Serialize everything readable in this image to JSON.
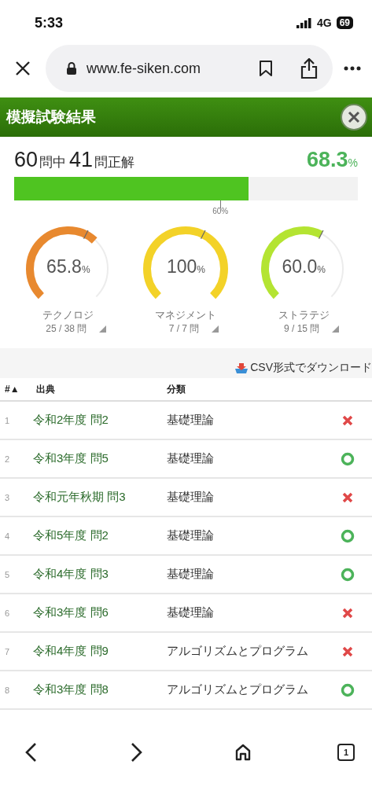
{
  "status_bar": {
    "time": "5:33",
    "network": "4G",
    "battery": "69"
  },
  "browser": {
    "url": "www.fe-siken.com"
  },
  "header": {
    "title": "模擬試験結果"
  },
  "score": {
    "total": "60",
    "total_unit": "問中",
    "correct": "41",
    "correct_unit": "問正解",
    "rate": "68.3",
    "rate_unit": "%",
    "level": 0.683,
    "pass_mark": "60%"
  },
  "gauges": [
    {
      "value": "65.8",
      "unit": "%",
      "color": "#e8892f",
      "label": "テクノロジ",
      "count": "25 / 38 問"
    },
    {
      "value": "100",
      "unit": "%",
      "color": "#f3d228",
      "label": "マネジメント",
      "count": "7 / 7 問"
    },
    {
      "value": "60.0",
      "unit": "%",
      "color": "#b4e432",
      "label": "ストラテジ",
      "count": "9 / 15 問"
    }
  ],
  "download": "CSV形式でダウンロード",
  "table": {
    "columns": [
      "#▲",
      "出典",
      "分類"
    ],
    "rows": [
      {
        "no": "1",
        "source": "令和2年度 問2",
        "category": "基礎理論",
        "correct": false
      },
      {
        "no": "2",
        "source": "令和3年度 問5",
        "category": "基礎理論",
        "correct": true
      },
      {
        "no": "3",
        "source": "令和元年秋期 問3",
        "category": "基礎理論",
        "correct": false
      },
      {
        "no": "4",
        "source": "令和5年度 問2",
        "category": "基礎理論",
        "correct": true
      },
      {
        "no": "5",
        "source": "令和4年度 問3",
        "category": "基礎理論",
        "correct": true
      },
      {
        "no": "6",
        "source": "令和3年度 問6",
        "category": "基礎理論",
        "correct": false
      },
      {
        "no": "7",
        "source": "令和4年度 問9",
        "category": "アルゴリズムとプログラム",
        "correct": false
      },
      {
        "no": "8",
        "source": "令和3年度 問8",
        "category": "アルゴリズムとプログラム",
        "correct": true
      }
    ]
  },
  "bottom_nav": {
    "tabs": "1"
  }
}
